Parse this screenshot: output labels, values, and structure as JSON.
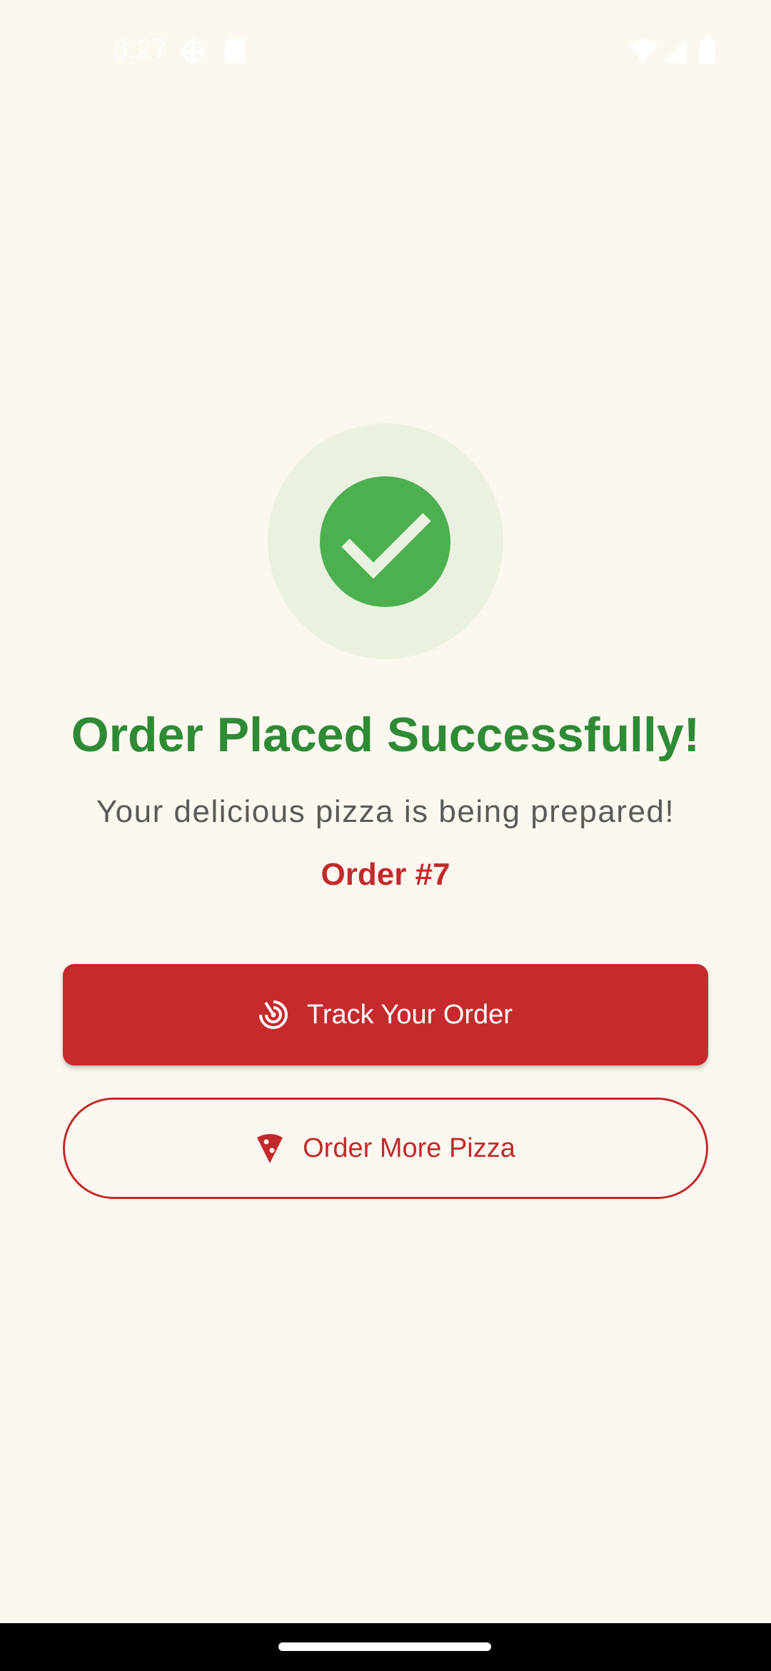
{
  "status_bar": {
    "time": "8:27",
    "left_icons": [
      "location-crosshair-icon",
      "sd-card-icon"
    ],
    "right_icons": [
      "wifi-icon",
      "signal-icon",
      "battery-icon"
    ]
  },
  "success": {
    "icon": "check-circle-icon",
    "title": "Order Placed Successfully!",
    "subtitle": "Your delicious pizza is being prepared!",
    "order_number": "Order #7"
  },
  "actions": {
    "track": {
      "label": "Track Your Order",
      "icon": "track-radar-icon"
    },
    "order_more": {
      "label": "Order More Pizza",
      "icon": "pizza-slice-icon"
    }
  },
  "colors": {
    "background": "#FCF8F0",
    "success_green": "#4CB050",
    "title_green": "#2F8A35",
    "accent_red": "#C62A2D"
  }
}
